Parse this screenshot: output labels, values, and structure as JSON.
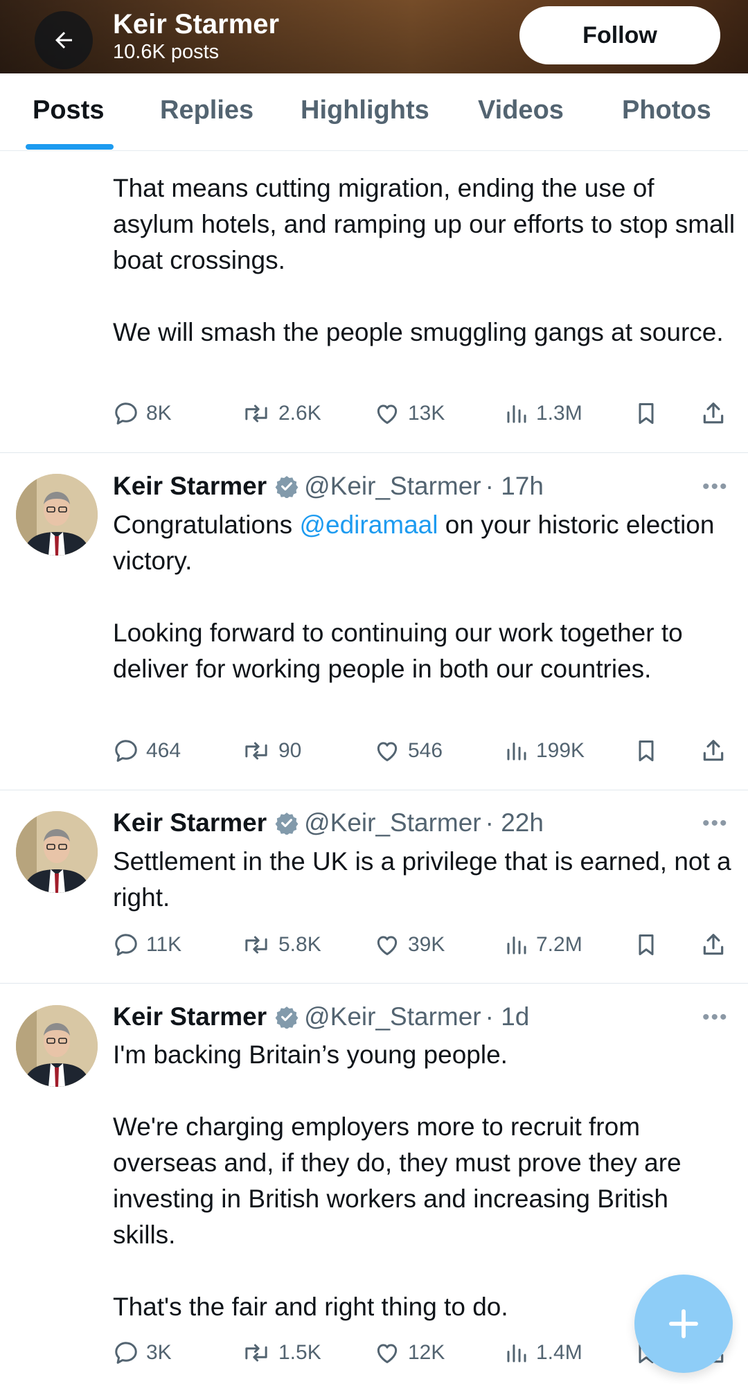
{
  "header": {
    "name": "Keir Starmer",
    "post_count": "10.6K posts",
    "follow_label": "Follow",
    "back_icon": "arrow-left-icon"
  },
  "tabs": [
    {
      "label": "Posts",
      "active": true
    },
    {
      "label": "Replies",
      "active": false
    },
    {
      "label": "Highlights",
      "active": false
    },
    {
      "label": "Videos",
      "active": false
    },
    {
      "label": "Photos",
      "active": false
    }
  ],
  "colors": {
    "accent": "#1d9bf0",
    "fab": "#8ecdf7",
    "secondary_text": "#536471",
    "primary_text": "#0f1419"
  },
  "posts": [
    {
      "continued": true,
      "paragraphs": [
        "That means cutting migration, ending the use of asylum hotels, and ramping up our efforts to stop small boat crossings.",
        "We will smash the people smuggling gangs at source."
      ],
      "stats": {
        "replies": "8K",
        "reposts": "2.6K",
        "likes": "13K",
        "views": "1.3M"
      }
    },
    {
      "name": "Keir Starmer",
      "handle": "@Keir_Starmer",
      "time": "· 17h",
      "para1_prefix": "Congratulations ",
      "mention": "@ediramaal",
      "para1_suffix": " on your historic election victory.",
      "para2": "Looking forward to continuing our work together to deliver for working people in both our countries.",
      "stats": {
        "replies": "464",
        "reposts": "90",
        "likes": "546",
        "views": "199K"
      }
    },
    {
      "name": "Keir Starmer",
      "handle": "@Keir_Starmer",
      "time": "· 22h",
      "paragraphs": [
        "Settlement in the UK is a privilege that is earned, not a right."
      ],
      "stats": {
        "replies": "11K",
        "reposts": "5.8K",
        "likes": "39K",
        "views": "7.2M"
      }
    },
    {
      "name": "Keir Starmer",
      "handle": "@Keir_Starmer",
      "time": "· 1d",
      "paragraphs": [
        "I'm backing Britain’s young people.",
        "We're charging employers more to recruit from overseas and, if they do, they must prove they are investing in British workers and increasing British skills.",
        "That's the fair and right thing to do."
      ],
      "stats": {
        "replies": "3K",
        "reposts": "1.5K",
        "likes": "12K",
        "views": "1.4M"
      }
    }
  ],
  "icons": {
    "reply": "speech-bubble-icon",
    "repost": "repost-arrows-icon",
    "like": "heart-icon",
    "views": "bar-chart-icon",
    "bookmark": "bookmark-icon",
    "share": "share-upload-icon",
    "verified": "verified-badge-icon",
    "more": "more-dots-icon",
    "compose": "plus-icon"
  }
}
